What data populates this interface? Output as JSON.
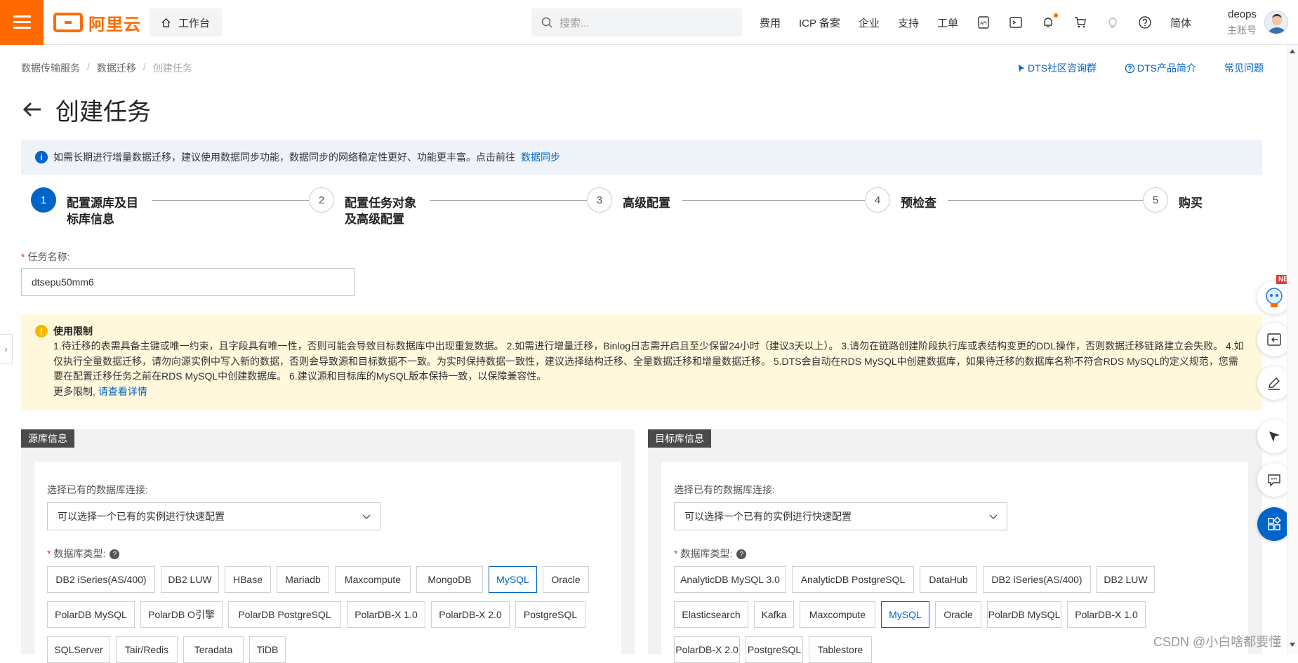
{
  "header": {
    "logo_text": "阿里云",
    "workbench_label": "工作台",
    "search_placeholder": "搜索...",
    "links": [
      "费用",
      "ICP 备案",
      "企业",
      "支持",
      "工单"
    ],
    "lang": "简体",
    "user_name": "deops",
    "user_role": "主账号"
  },
  "breadcrumb": [
    "数据传输服务",
    "数据迁移",
    "创建任务"
  ],
  "top_links": {
    "community": "DTS社区咨询群",
    "intro": "DTS产品简介",
    "faq": "常见问题"
  },
  "page_title": "创建任务",
  "notice": {
    "text": "如需长期进行增量数据迁移，建议使用数据同步功能，数据同步的网络稳定性更好、功能更丰富。点击前往",
    "link": "数据同步"
  },
  "steps": [
    {
      "num": "1",
      "line1": "配置源库及目",
      "line2": "标库信息"
    },
    {
      "num": "2",
      "line1": "配置任务对象",
      "line2": "及高级配置"
    },
    {
      "num": "3",
      "line1": "高级配置",
      "line2": ""
    },
    {
      "num": "4",
      "line1": "预检查",
      "line2": ""
    },
    {
      "num": "5",
      "line1": "购买",
      "line2": ""
    }
  ],
  "task_name": {
    "label": "任务名称:",
    "value": "dtsepu50mm6"
  },
  "usage_limit": {
    "title": "使用限制",
    "body": "1.待迁移的表需具备主键或唯一约束，且字段具有唯一性，否则可能会导致目标数据库中出现重复数据。 2.如需进行增量迁移，Binlog日志需开启且至少保留24小时（建议3天以上）。 3.请勿在链路创建阶段执行库或表结构变更的DDL操作，否则数据迁移链路建立会失败。 4.如仅执行全量数据迁移，请勿向源实例中写入新的数据，否则会导致源和目标数据不一致。为实时保持数据一致性，建议选择结构迁移、全量数据迁移和增量数据迁移。 5.DTS会自动在RDS MySQL中创建数据库，如果待迁移的数据库名称不符合RDS MySQL的定义规范，您需要在配置迁移任务之前在RDS MySQL中创建数据库。 6.建议源和目标库的MySQL版本保持一致，以保障兼容性。",
    "more_prefix": "更多限制,",
    "more_link": "请查看详情"
  },
  "source": {
    "tag": "源库信息",
    "conn_label": "选择已有的数据库连接:",
    "conn_placeholder": "可以选择一个已有的实例进行快速配置",
    "dbtype_label": "数据库类型:",
    "selected": "MySQL",
    "db_types": [
      "DB2 iSeries(AS/400)",
      "DB2 LUW",
      "HBase",
      "Mariadb",
      "Maxcompute",
      "MongoDB",
      "MySQL",
      "Oracle",
      "PolarDB MySQL",
      "PolarDB O引擎",
      "PolarDB PostgreSQL",
      "PolarDB-X 1.0",
      "PolarDB-X 2.0",
      "PostgreSQL",
      "SQLServer",
      "Tair/Redis",
      "Teradata",
      "TiDB"
    ]
  },
  "target": {
    "tag": "目标库信息",
    "conn_label": "选择已有的数据库连接:",
    "conn_placeholder": "可以选择一个已有的实例进行快速配置",
    "dbtype_label": "数据库类型:",
    "selected": "MySQL",
    "db_types": [
      "AnalyticDB MySQL 3.0",
      "AnalyticDB PostgreSQL",
      "DataHub",
      "DB2 iSeries(AS/400)",
      "DB2 LUW",
      "Elasticsearch",
      "Kafka",
      "Maxcompute",
      "MySQL",
      "Oracle",
      "PolarDB MySQL",
      "PolarDB-X 1.0",
      "PolarDB-X 2.0",
      "PostgreSQL",
      "Tablestore"
    ]
  },
  "float_badge": "NEW",
  "watermark": "CSDN @小白啥都要懂"
}
